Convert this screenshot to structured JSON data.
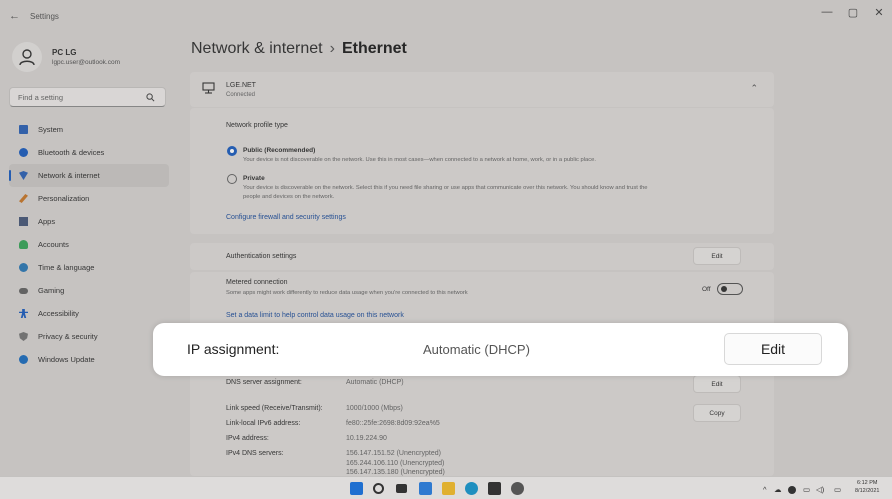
{
  "window": {
    "title": "Settings",
    "back_icon": "back-arrow-icon",
    "controls": [
      "—",
      "▢",
      "✕"
    ]
  },
  "profile": {
    "name": "PC LG",
    "email": "lgpc.user@outlook.com"
  },
  "search": {
    "placeholder": "Find a setting"
  },
  "sidebar": {
    "items": [
      {
        "label": "System",
        "icon": "display-icon",
        "color": "#2f63b5"
      },
      {
        "label": "Bluetooth & devices",
        "icon": "bluetooth-icon",
        "color": "#1f5fbf"
      },
      {
        "label": "Network & internet",
        "icon": "wifi-icon",
        "color": "#2f63b5",
        "active": true
      },
      {
        "label": "Personalization",
        "icon": "brush-icon",
        "color": "#c8792c"
      },
      {
        "label": "Apps",
        "icon": "apps-icon",
        "color": "#4a5a7a"
      },
      {
        "label": "Accounts",
        "icon": "person-icon",
        "color": "#3aa55a"
      },
      {
        "label": "Time & language",
        "icon": "globe-clock-icon",
        "color": "#2f7ab5"
      },
      {
        "label": "Gaming",
        "icon": "gamepad-icon",
        "color": "#666"
      },
      {
        "label": "Accessibility",
        "icon": "accessibility-icon",
        "color": "#1f5fbf"
      },
      {
        "label": "Privacy & security",
        "icon": "shield-icon",
        "color": "#777"
      },
      {
        "label": "Windows Update",
        "icon": "update-icon",
        "color": "#1f6fbf"
      }
    ]
  },
  "page": {
    "title": "Network & internet",
    "separator": "›",
    "subtitle": "Ethernet"
  },
  "ethernet": {
    "name": "LGE.NET",
    "status": "Connected"
  },
  "profile_type": {
    "heading": "Network profile type",
    "public_label": "Public (Recommended)",
    "public_desc": "Your device is not discoverable on the network. Use this in most cases—when connected to a network at home, work, or in a public place.",
    "private_label": "Private",
    "private_desc_1": "Your device is discoverable on the network. Select this if you need file sharing or use apps that communicate over this network. You should know and trust the",
    "private_desc_2": "people and devices on the network.",
    "firewall_link": "Configure firewall and security settings"
  },
  "auth": {
    "label": "Authentication settings",
    "button": "Edit"
  },
  "metered": {
    "label": "Metered connection",
    "desc": "Some apps might work differently to reduce data usage when you're connected to this network",
    "toggle_label": "Off",
    "data_limit_link": "Set a data limit to help control data usage on this network"
  },
  "ip": {
    "label": "IP assignment:",
    "value": "Automatic (DHCP)",
    "button": "Edit"
  },
  "dns": {
    "label": "DNS server assignment:",
    "value": "Automatic (DHCP)",
    "button": "Edit"
  },
  "details": {
    "copy_button": "Copy",
    "link_speed_label": "Link speed (Receive/Transmit):",
    "link_speed_value": "1000/1000 (Mbps)",
    "ipv6_label": "Link-local IPv6 address:",
    "ipv6_value": "fe80::25fe:2698:8d09:92ea%5",
    "ipv4_label": "IPv4 address:",
    "ipv4_value": "10.19.224.90",
    "dns_label": "IPv4 DNS servers:",
    "dns_1": "156.147.151.52 (Unencrypted)",
    "dns_2": "165.244.106.110 (Unencrypted)",
    "dns_3": "156.147.135.180 (Unencrypted)"
  },
  "taskbar": {
    "icons": [
      "start-icon",
      "search-icon",
      "taskview-icon",
      "widgets-icon",
      "file-explorer-icon",
      "edge-icon",
      "store-icon",
      "settings-icon"
    ],
    "time": "6:12 PM",
    "date": "8/12/2021"
  }
}
